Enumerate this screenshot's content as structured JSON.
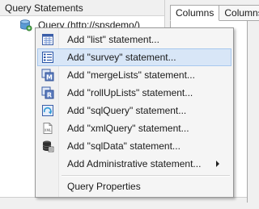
{
  "panel": {
    "title": "Query Statements"
  },
  "tree": {
    "root_label": "Query (http://spsdemo/)"
  },
  "right_panel": {
    "tabs": [
      "Columns",
      "Columns"
    ]
  },
  "context_menu": {
    "items": [
      {
        "label": "Add \"list\" statement...",
        "icon": "list-icon"
      },
      {
        "label": "Add \"survey\" statement...",
        "icon": "survey-icon",
        "highlighted": true
      },
      {
        "label": "Add \"mergeLists\" statement...",
        "icon": "merge-lists-icon"
      },
      {
        "label": "Add \"rollUpLists\" statement...",
        "icon": "roll-up-lists-icon"
      },
      {
        "label": "Add \"sqlQuery\" statement...",
        "icon": "sql-query-icon"
      },
      {
        "label": "Add \"xmlQuery\" statement...",
        "icon": "xml-query-icon"
      },
      {
        "label": "Add \"sqlData\" statement...",
        "icon": "sql-data-icon"
      },
      {
        "label": "Add Administrative statement...",
        "has_submenu": true
      },
      {
        "label": "Query Properties"
      }
    ]
  },
  "colors": {
    "highlight": "#d8e6f7",
    "highlight_border": "#a8c8ee",
    "menu_bg": "#f5f5f5"
  }
}
